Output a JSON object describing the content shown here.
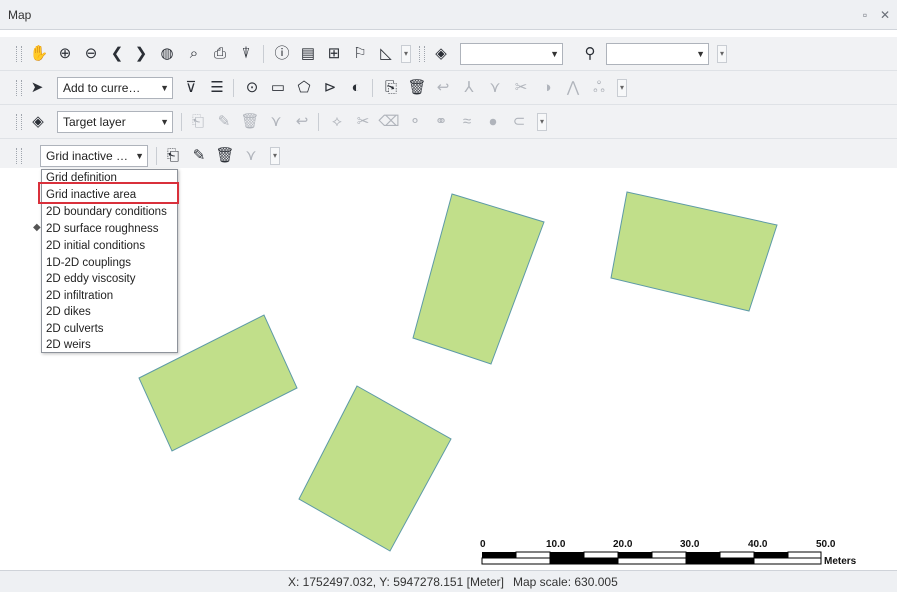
{
  "window": {
    "title": "Map",
    "maximize_glyph": "▫",
    "close_glyph": "✕"
  },
  "toolbar1": {
    "icons": [
      "pan-hand-icon",
      "zoom-in-icon",
      "zoom-out-icon",
      "previous-extent-icon",
      "next-extent-icon",
      "full-extent-icon",
      "zoom-to-selection-icon",
      "zoom-to-layer-icon",
      "clear-selection-icon",
      "identify-icon",
      "attributes-icon",
      "measure-icon",
      "bookmark-icon",
      "chart-icon"
    ],
    "layer_combo_value": "",
    "search_combo_value": ""
  },
  "toolbar2": {
    "selection_mode_value": "Add to curre…",
    "icons": [
      "select-by-attribute-icon",
      "list-icon",
      "mouse-select-icon",
      "rectangle-select-icon",
      "polygon-select-icon",
      "deselect-icon",
      "invert-selection-icon",
      "edit-features-icon",
      "delete-icon",
      "undo-icon",
      "split-icon",
      "reshape-icon",
      "scissors-icon",
      "toggle-icon",
      "vertex-icon",
      "node-icon"
    ]
  },
  "toolbar3": {
    "target_layer_value": "Target layer",
    "icons": [
      "new-feature-icon",
      "pencil-icon",
      "delete-feature-icon",
      "reshape-feature-icon",
      "undo-edit-icon",
      "node-edit-icon",
      "cut-icon",
      "erase-icon",
      "vertex-a-icon",
      "vertex-b-icon",
      "buffer-icon",
      "points-icon",
      "capsule-icon"
    ]
  },
  "toolbar4": {
    "grid_layer_value": "Grid inactive …",
    "icons": [
      "new-grid-feature-icon",
      "grid-pencil-icon",
      "grid-delete-icon",
      "grid-reshape-icon"
    ]
  },
  "dropdown": {
    "items": [
      "Grid definition",
      "Grid inactive area",
      "2D boundary conditions",
      "2D surface roughness",
      "2D initial conditions",
      "1D-2D couplings",
      "2D eddy viscosity",
      "2D infiltration",
      "2D dikes",
      "2D culverts",
      "2D weirs"
    ],
    "selected": "Grid inactive area"
  },
  "scale_bar": {
    "ticks": [
      "0",
      "10.0",
      "20.0",
      "30.0",
      "40.0",
      "50.0"
    ],
    "unit": "Meters"
  },
  "status": {
    "coords": "X: 1752497.032, Y: 5947278.151 [Meter]",
    "scale": "Map scale: 630.005"
  },
  "colors": {
    "polygon_fill": "#c1df8a",
    "polygon_stroke": "#5d9aa6",
    "highlight": "#d9303b"
  }
}
